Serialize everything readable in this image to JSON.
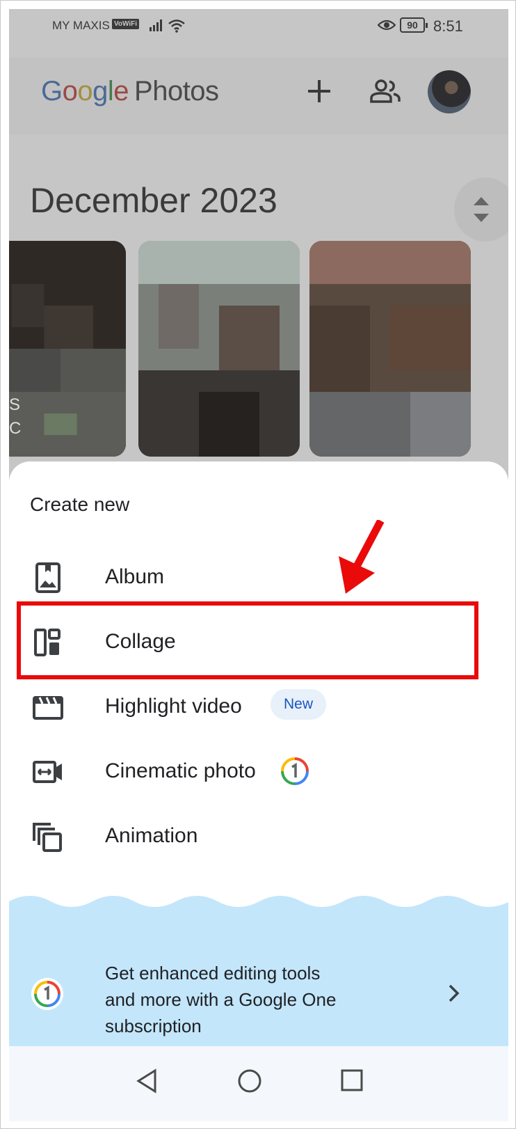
{
  "status_bar": {
    "carrier": "MY MAXIS",
    "vowifi": "VoWiFi",
    "battery": "90",
    "time": "8:51",
    "icons": [
      "signal-icon",
      "wifi-icon",
      "eye-icon",
      "battery-icon"
    ]
  },
  "app_bar": {
    "logo_letters": [
      "G",
      "o",
      "o",
      "g",
      "l",
      "e"
    ],
    "logo_product": "Photos",
    "actions": [
      "plus-icon",
      "people-icon",
      "avatar"
    ]
  },
  "gallery": {
    "month_heading": "December 2023",
    "edge_letters": [
      "S",
      "C"
    ]
  },
  "sheet": {
    "title": "Create new",
    "items": [
      {
        "label": "Album",
        "icon": "album-icon"
      },
      {
        "label": "Collage",
        "icon": "collage-icon"
      },
      {
        "label": "Highlight video",
        "icon": "movie-icon",
        "badge": "New"
      },
      {
        "label": "Cinematic photo",
        "icon": "cinematic-icon",
        "badge_icon": "google-one-icon"
      },
      {
        "label": "Animation",
        "icon": "animation-icon"
      }
    ]
  },
  "promo": {
    "text_lines": [
      "Get enhanced editing tools",
      "and more with a Google One",
      "subscription"
    ],
    "icon": "google-one-icon"
  },
  "nav_bar": {
    "buttons": [
      "back-icon",
      "home-icon",
      "recents-icon"
    ]
  },
  "annotation": {
    "highlight_color": "#ea0a0a",
    "highlighted_item": "Collage"
  },
  "colors": {
    "promo_bg": "#c3e6fb",
    "badge_bg": "#e8f0fa",
    "badge_text": "#1a55c0"
  }
}
